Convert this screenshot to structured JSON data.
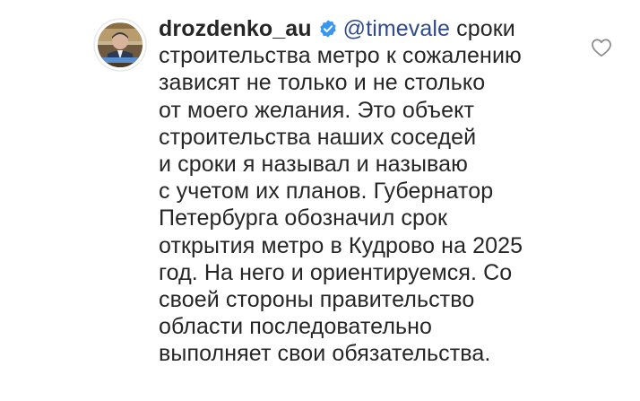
{
  "comment": {
    "author": {
      "username": "drozdenko_au",
      "verified_icon": "verified-badge-icon",
      "avatar_icon": "profile-photo"
    },
    "mention": "@timevale",
    "first_line_text": "сроки",
    "lines": [
      "строительства метро к сожалению",
      "зависят не только и не столько",
      "от моего желания. Это объект",
      "строительства наших соседей",
      "и сроки я называл и называю",
      "с учетом их планов. Губернатор",
      "Петербурга обозначил срок",
      "открытия метро в Кудрово на 2025",
      "год. На него и ориентируемся. Со",
      "своей стороны правительство",
      "области последовательно",
      "выполняет свои обязательства."
    ],
    "like_icon": "heart-outline-icon"
  },
  "colors": {
    "text": "#262626",
    "mention": "#2f4b8c",
    "verified": "#3897f0",
    "heart_outline": "#8e8e8e"
  }
}
